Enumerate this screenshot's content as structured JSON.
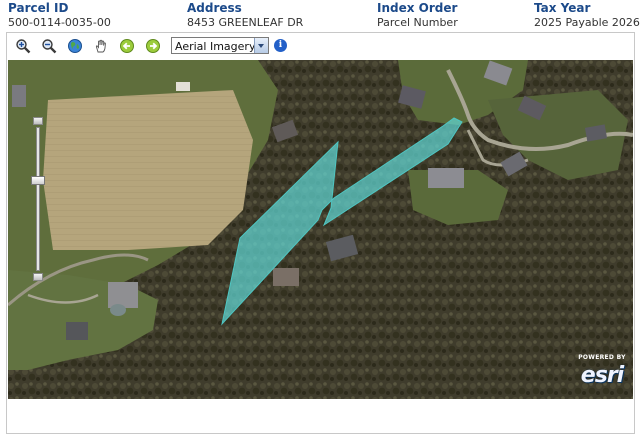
{
  "header": {
    "columns": [
      {
        "label": "Parcel ID",
        "value": "500-0114-0035-00"
      },
      {
        "label": "Address",
        "value": "8453 GREENLEAF DR"
      },
      {
        "label": "Index Order",
        "value": "Parcel Number"
      },
      {
        "label": "Tax Year",
        "value": "2025 Payable 2026"
      }
    ]
  },
  "toolbar": {
    "tools": [
      {
        "name": "zoom-in",
        "icon": "magnifier-plus-icon"
      },
      {
        "name": "zoom-out",
        "icon": "magnifier-minus-icon"
      },
      {
        "name": "full-extent",
        "icon": "globe-icon"
      },
      {
        "name": "pan",
        "icon": "hand-icon"
      },
      {
        "name": "previous-extent",
        "icon": "arrow-left-icon"
      },
      {
        "name": "next-extent",
        "icon": "arrow-right-icon"
      }
    ],
    "layer_select": {
      "value": "Aerial Imagery"
    },
    "info_icon": "info-icon"
  },
  "map": {
    "zoom_level_fraction": 0.36,
    "parcel_fill_color": "#5fd6d2",
    "attribution": {
      "top": "POWERED BY",
      "main": "esri"
    }
  }
}
